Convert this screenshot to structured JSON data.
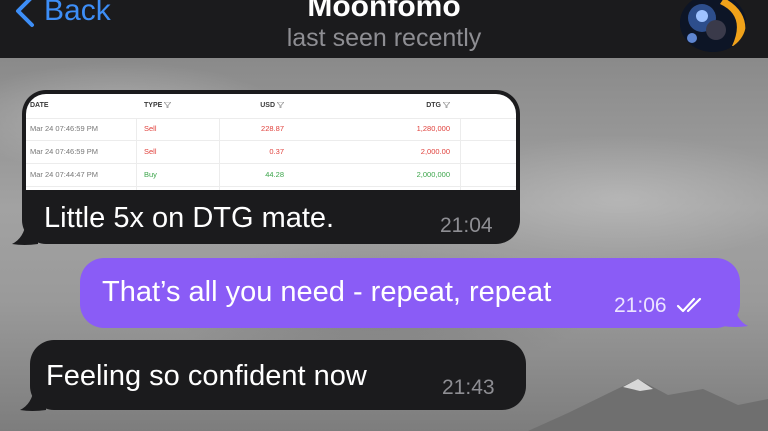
{
  "header": {
    "back_label": "Back",
    "contact_name": "Moonfomo",
    "status": "last seen recently"
  },
  "messages": [
    {
      "text": "Little 5x on DTG mate.",
      "time": "21:04",
      "direction": "incoming",
      "attachment": {
        "columns": [
          "DATE",
          "TYPE",
          "USD",
          "DTG"
        ],
        "rows": [
          [
            "Mar 24 07:46:59 PM",
            "Sell",
            "228.87",
            "1,280,000"
          ],
          [
            "Mar 24 07:46:59 PM",
            "Sell",
            "0.37",
            "2,000.00"
          ],
          [
            "Mar 24 07:44:47 PM",
            "Buy",
            "44.28",
            "2,000,000"
          ]
        ]
      }
    },
    {
      "text": "That’s all you need - repeat, repeat",
      "time": "21:06",
      "direction": "outgoing",
      "status_icon": "double-check-icon"
    },
    {
      "text": "Feeling so confident now",
      "time": "21:43",
      "direction": "incoming"
    }
  ],
  "colors": {
    "header_bg": "#1b1b1d",
    "accent_blue": "#3d8ef7",
    "outgoing_bubble": "#8a5cf6",
    "incoming_bubble": "#1b1b1d",
    "sell": "#e0413c",
    "buy": "#3ca54b"
  }
}
